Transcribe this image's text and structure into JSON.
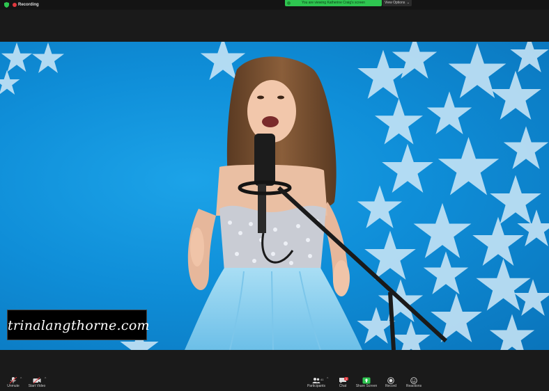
{
  "topbar": {
    "recording_label": "Recording",
    "share_banner": "You are viewing Katherine Craig's screen",
    "view_options": "View Options"
  },
  "video": {
    "watermark": "trinalangthorne.com"
  },
  "toolbar": {
    "unmute": "Unmute",
    "start_video": "Start Video",
    "participants": "Participants",
    "participants_count": "41",
    "chat": "Chat",
    "chat_badge": "3",
    "share_screen": "Share Screen",
    "record": "Record",
    "reactions": "Reactions"
  },
  "colors": {
    "recording": "#e0383e",
    "share_banner": "#2ec550",
    "share_screen_icon": "#2ec550",
    "backdrop_blue": "#0f8ed8",
    "dress_blue": "#8fd0ef"
  },
  "icons": [
    "shield-icon",
    "recording-dot-icon",
    "microphone-muted-icon",
    "video-camera-off-icon",
    "participants-icon",
    "chat-icon",
    "share-screen-icon",
    "record-icon",
    "reactions-icon",
    "chevron-down-icon"
  ]
}
